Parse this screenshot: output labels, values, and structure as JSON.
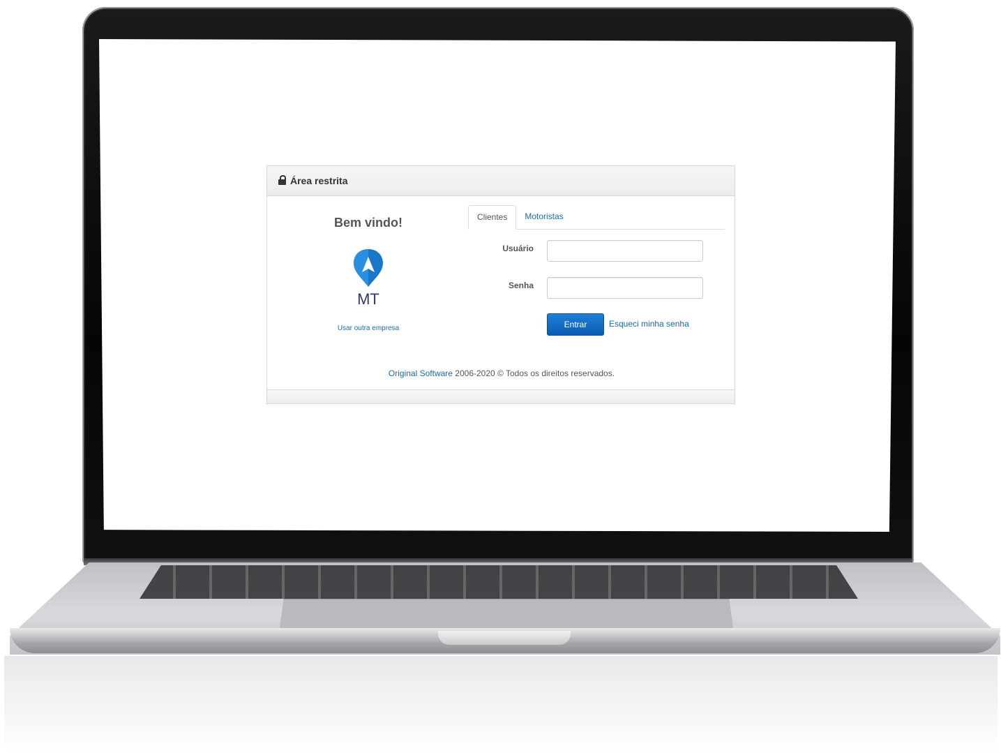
{
  "panel": {
    "title": "Área restrita",
    "title_icon": "lock-icon"
  },
  "welcome": {
    "heading": "Bem vindo!",
    "logo_text": "MT",
    "logo_icon": "map-pin-navigation-icon",
    "other_company_link": "Usar outra empresa"
  },
  "tabs": [
    {
      "label": "Clientes",
      "active": true
    },
    {
      "label": "Motoristas",
      "active": false
    }
  ],
  "form": {
    "username_label": "Usuário",
    "username_value": "",
    "password_label": "Senha",
    "password_value": "",
    "submit_label": "Entrar",
    "forgot_label": "Esqueci minha senha"
  },
  "footer": {
    "company_link": "Original Software",
    "copyright": " 2006-2020 © Todos os direitos reservados."
  },
  "colors": {
    "link": "#1c6aa6",
    "button": "#0b5cb3",
    "logo_blue": "#1976c8",
    "logo_text": "#2d3a6b"
  }
}
